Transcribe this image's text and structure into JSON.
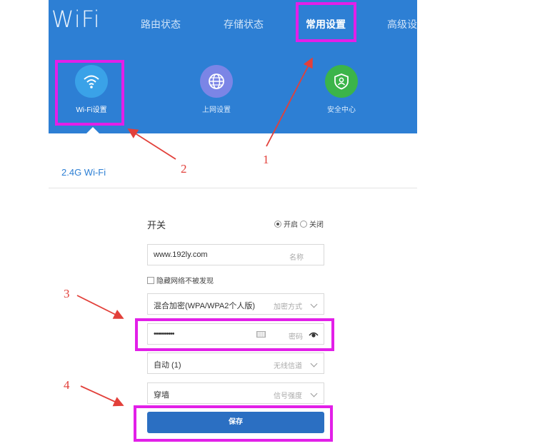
{
  "header": {
    "logo": "iWiFi",
    "nav": [
      "路由状态",
      "存储状态",
      "常用设置",
      "高级设"
    ],
    "active_nav": "常用设置"
  },
  "icon_tiles": [
    {
      "label": "Wi-Fi设置",
      "icon": "wifi-icon",
      "color": "#3aa2e8",
      "active": true
    },
    {
      "label": "上网设置",
      "icon": "globe-icon",
      "color": "#7b85e6",
      "active": false
    },
    {
      "label": "安全中心",
      "icon": "shield-icon",
      "color": "#3bb44a",
      "active": false
    }
  ],
  "section_title": "2.4G Wi-Fi",
  "form": {
    "switch_label": "开关",
    "radio_on": "开启",
    "radio_off": "关闭",
    "ssid_value": "www.192ly.com",
    "ssid_placeholder": "名称",
    "hide_network_label": "隐藏网络不被发现",
    "encryption_value": "混合加密(WPA/WPA2个人版)",
    "encryption_placeholder": "加密方式",
    "password_value": "••••••••••",
    "password_placeholder": "密码",
    "channel_value": "自动 (1)",
    "channel_placeholder": "无线信道",
    "strength_value": "穿墙",
    "strength_placeholder": "信号强度",
    "save_label": "保存"
  },
  "annotations": [
    "1",
    "2",
    "3",
    "4"
  ],
  "colors": {
    "header": "#2d7fd4",
    "highlight": "#e21fe8",
    "arrow": "#e2403a",
    "button": "#2b6fc2"
  }
}
